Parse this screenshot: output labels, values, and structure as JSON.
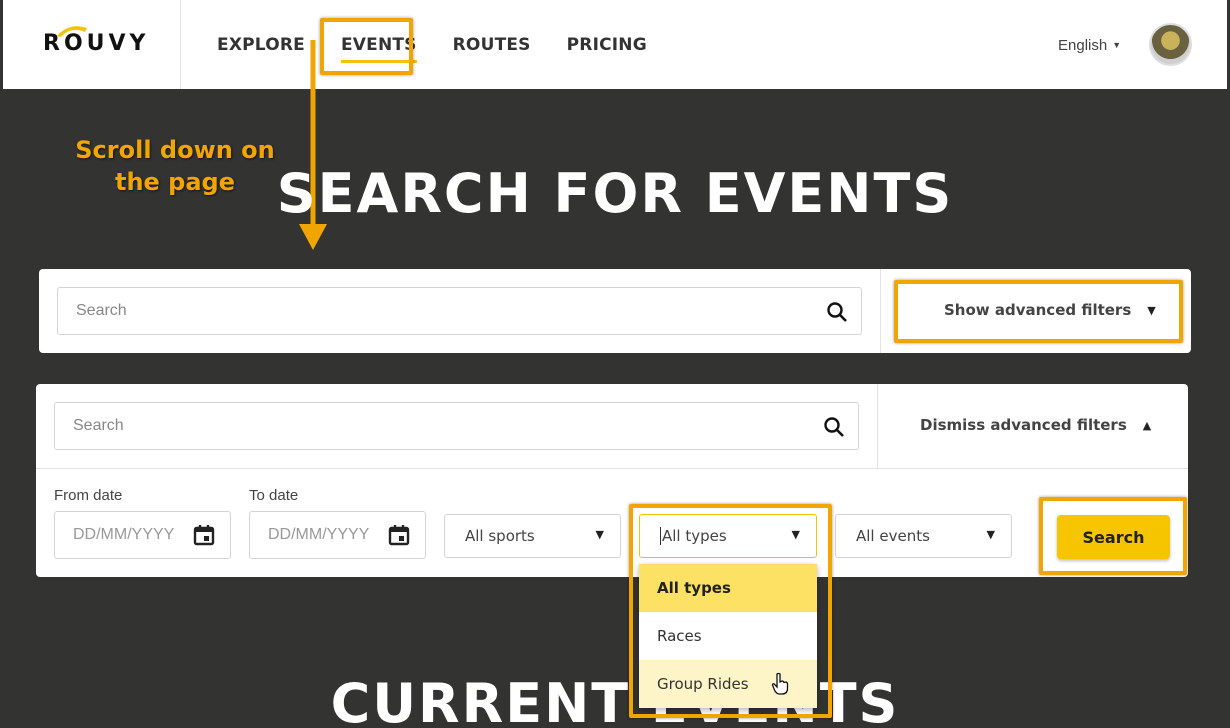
{
  "brand": {
    "logo_text": "ROUVY"
  },
  "nav": {
    "items": [
      "EXPLORE",
      "EVENTS",
      "ROUTES",
      "PRICING"
    ],
    "active": "EVENTS"
  },
  "language": {
    "label": "English"
  },
  "annotation": {
    "instruction": "Scroll down on the page",
    "color": "#f0a500"
  },
  "page": {
    "heading": "SEARCH FOR EVENTS",
    "next_heading": "CURRENT EVENTS"
  },
  "collapsed_panel": {
    "search_placeholder": "Search",
    "toggle_label": "Show advanced filters"
  },
  "expanded_panel": {
    "search_placeholder": "Search",
    "toggle_label": "Dismiss advanced filters",
    "from_date": {
      "label": "From date",
      "placeholder": "DD/MM/YYYY"
    },
    "to_date": {
      "label": "To date",
      "placeholder": "DD/MM/YYYY"
    },
    "sports_select": "All sports",
    "types_select": "All types",
    "events_select": "All events",
    "search_button": "Search"
  },
  "types_menu": {
    "options": [
      "All types",
      "Races",
      "Group Rides"
    ],
    "selected": "All types",
    "hovered": "Group Rides"
  },
  "colors": {
    "background": "#333331",
    "accent": "#f7c400",
    "annotation": "#f0a500"
  }
}
